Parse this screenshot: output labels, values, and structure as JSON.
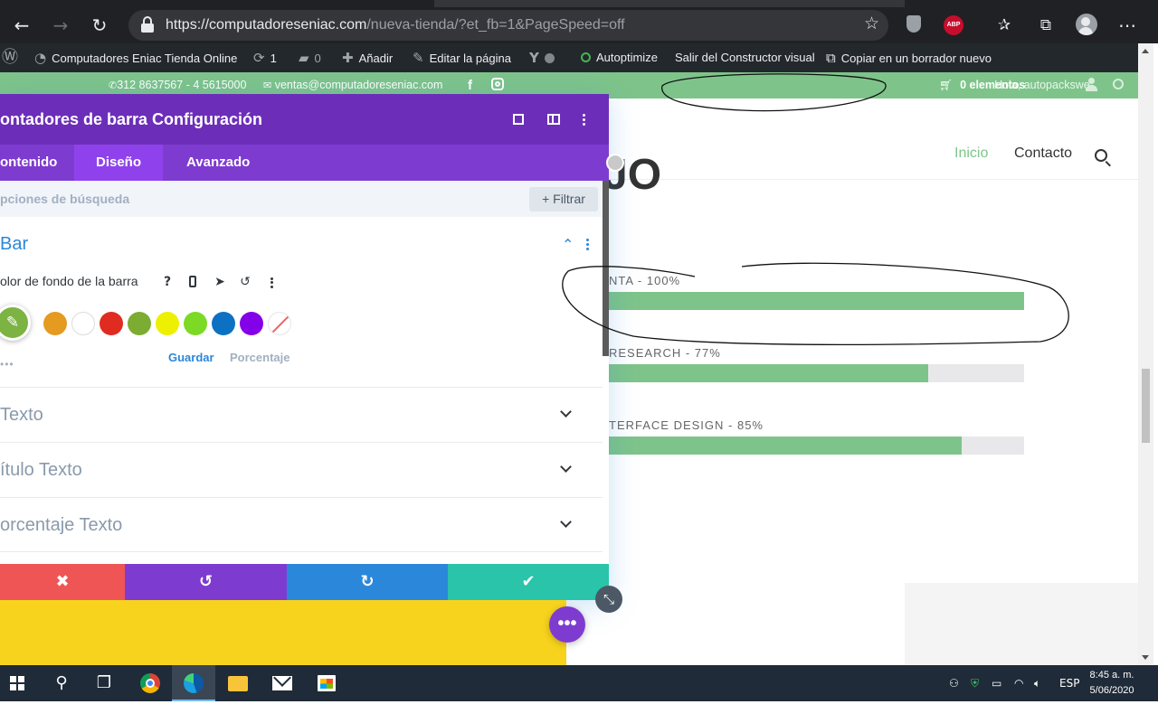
{
  "browser": {
    "url_main": "https://computadoreseniac.com",
    "url_rest": "/nueva-tienda/?et_fb=1&PageSpeed=off",
    "abp_label": "ABP"
  },
  "adminbar": {
    "site_name": "Computadores Eniac Tienda Online",
    "updates_count": "1",
    "comments_count": "0",
    "add_new": "Añadir",
    "edit_page": "Editar la página",
    "autoptimize": "Autoptimize",
    "exit_builder": "Salir del Constructor visual",
    "copy_draft": "Copiar en un borrador nuevo"
  },
  "site_top": {
    "phone": "312 8637567 - 4 5615000",
    "email": "ventas@computadoreseniac.com",
    "cart_overlap_text": "0 elementos",
    "account_overlap_text": "Hola, autopackswe"
  },
  "nav": {
    "items": [
      "Inicio",
      "Contacto"
    ],
    "active_color": "#7ec48a"
  },
  "page": {
    "heading_fragment": "JO"
  },
  "counters": [
    {
      "label": "NTA - 100%",
      "percent": 100
    },
    {
      "label": "RESEARCH - 77%",
      "percent": 77
    },
    {
      "label": "TERFACE DESIGN - 85%",
      "percent": 85
    }
  ],
  "panel": {
    "title": "ontadores de barra Configuración",
    "tabs": [
      "ontenido",
      "Diseño",
      "Avanzado"
    ],
    "active_tab": "Diseño",
    "search_placeholder": "pciones de búsqueda",
    "filter_label": "Filtrar",
    "group_title": "Bar",
    "field_label": "olor de fondo de la barra",
    "swatches": [
      "#e59a20",
      "#ffffff",
      "#e02b20",
      "#7cac32",
      "#edf000",
      "#7cda24",
      "#0c71c3",
      "#8300e9"
    ],
    "picker_color": "#7cb342",
    "dots": "•••",
    "save_link": "Guardar",
    "percent_link": "Porcentaje",
    "sections": [
      "Texto",
      "ítulo Texto",
      "orcentaje Texto"
    ],
    "footer_colors": {
      "cancel": "#ef5555",
      "undo": "#7e3bd0",
      "redo": "#2b87da",
      "save": "#29c4a9"
    }
  },
  "taskbar": {
    "lang": "ESP",
    "time": "8:45 a. m.",
    "date": "5/06/2020"
  }
}
